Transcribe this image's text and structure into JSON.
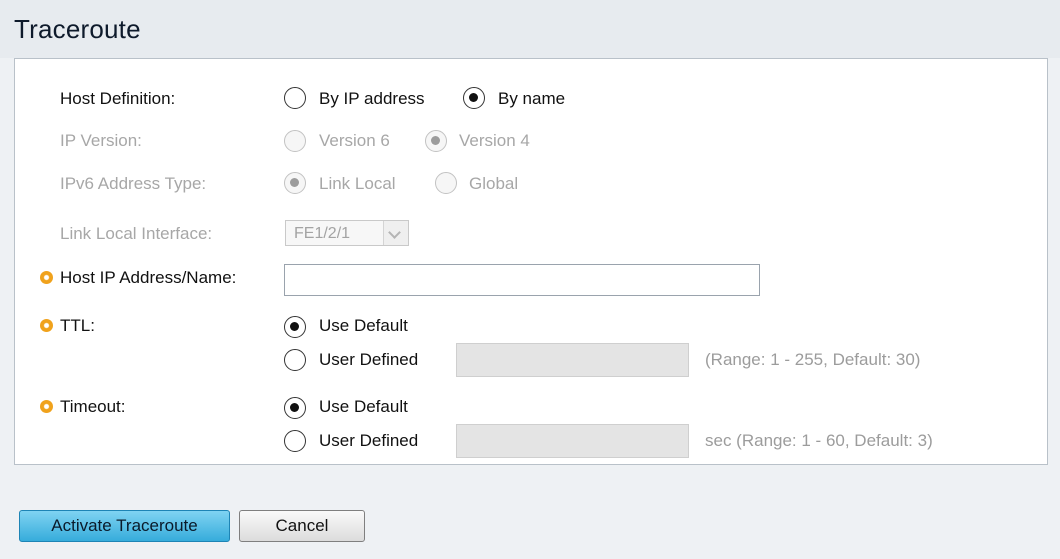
{
  "page": {
    "title": "Traceroute"
  },
  "form": {
    "host_definition": {
      "label": "Host Definition:",
      "options": [
        "By IP address",
        "By name"
      ],
      "selected": "By name"
    },
    "ip_version": {
      "label": "IP Version:",
      "options": [
        "Version 6",
        "Version 4"
      ],
      "selected": "Version 4",
      "disabled": true
    },
    "ipv6_address_type": {
      "label": "IPv6 Address Type:",
      "options": [
        "Link Local",
        "Global"
      ],
      "selected": "Link Local",
      "disabled": true
    },
    "link_local_interface": {
      "label": "Link Local Interface:",
      "value": "FE1/2/1",
      "disabled": true
    },
    "host_ip": {
      "label": "Host IP Address/Name:",
      "value": "",
      "required": true
    },
    "ttl": {
      "label": "TTL:",
      "required": true,
      "options": [
        "Use Default",
        "User Defined"
      ],
      "selected": "Use Default",
      "user_defined_value": "",
      "hint": "(Range: 1 - 255, Default: 30)"
    },
    "timeout": {
      "label": "Timeout:",
      "required": true,
      "options": [
        "Use Default",
        "User Defined"
      ],
      "selected": "Use Default",
      "user_defined_value": "",
      "hint": "sec (Range: 1 - 60, Default: 3)"
    }
  },
  "buttons": {
    "activate": "Activate Traceroute",
    "cancel": "Cancel"
  },
  "colors": {
    "required_icon": "#f0a21c",
    "primary_button": "#36acdb",
    "disabled_text": "#a7a7a7"
  }
}
